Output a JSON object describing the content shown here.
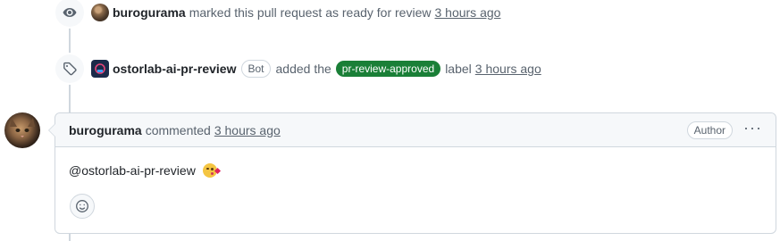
{
  "events": [
    {
      "icon": "eye-icon",
      "actor": "burogurama",
      "action": "marked this pull request as ready for review",
      "time": "3 hours ago"
    },
    {
      "icon": "tag-icon",
      "actor": "ostorlab-ai-pr-review",
      "bot_badge": "Bot",
      "action_before": "added the",
      "label": "pr-review-approved",
      "action_after": "label",
      "time": "3 hours ago",
      "label_color": "#1a7f37"
    }
  ],
  "comment": {
    "author": "burogurama",
    "action": "commented",
    "time": "3 hours ago",
    "author_badge": "Author",
    "more_menu": "···",
    "body_text": "@ostorlab-ai-pr-review",
    "emoji": "kissing-heart-emoji",
    "reaction_icon": "smiley-icon"
  }
}
